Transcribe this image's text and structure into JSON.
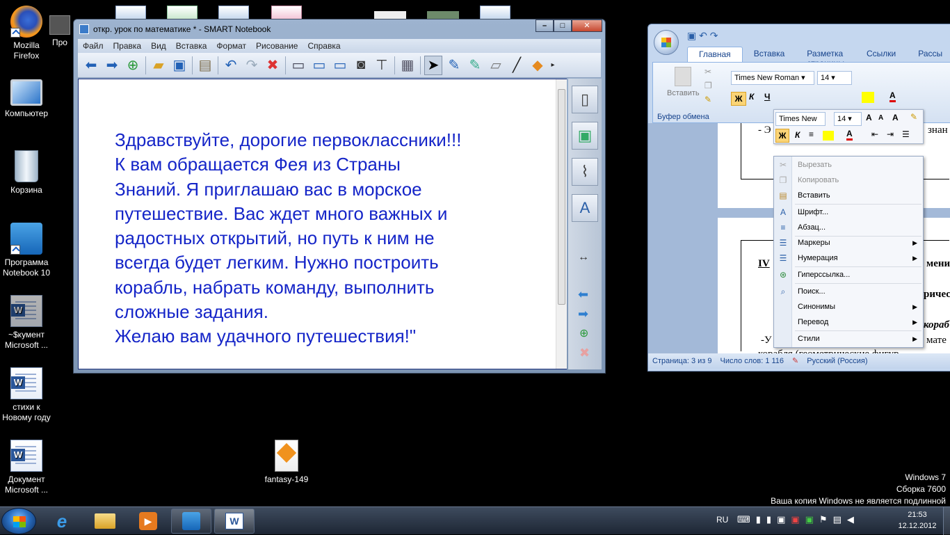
{
  "desktop_icons": [
    {
      "label1": "Mozilla",
      "label2": "Firefox",
      "icon": "firefox-icon"
    },
    {
      "label1": "Компьютер",
      "label2": "",
      "icon": "computer-icon"
    },
    {
      "label1": "Корзина",
      "label2": "",
      "icon": "recycle-bin-icon"
    },
    {
      "label1": "Программа",
      "label2": "Notebook 10",
      "icon": "smart-notebook-icon"
    },
    {
      "label1": "~$кумент",
      "label2": "Microsoft ...",
      "icon": "word-temp-icon"
    },
    {
      "label1": "стихи к",
      "label2": "Новому году",
      "icon": "word-doc-icon"
    },
    {
      "label1": "Документ",
      "label2": "Microsoft ...",
      "icon": "word-doc-icon"
    },
    {
      "label1": "fantasy-149",
      "label2": "",
      "icon": "scorm-icon"
    },
    {
      "label1": "Про",
      "label2": "",
      "icon": "program-icon"
    }
  ],
  "smart": {
    "title": "откр. урок по математике * - SMART Notebook",
    "menu": [
      "Файл",
      "Правка",
      "Вид",
      "Вставка",
      "Формат",
      "Рисование",
      "Справка"
    ],
    "page_text": "Здравствуйте, дорогие первоклассники!!!\nК вам обращается Фея из Страны\nЗнаний. Я приглашаю вас в морское\nпутешествие. Вас ждет много важных и\nрадостных открытий, но путь к ним не\nвсегда будет легким. Нужно построить\nкорабль, набрать команду, выполнить\nсложные задания.\nЖелаю вам удачного путешествия!\""
  },
  "word": {
    "tabs": [
      "Главная",
      "Вставка",
      "Разметка страницы",
      "Ссылки",
      "Рассы"
    ],
    "paste_label": "Вставить",
    "clipboard_label": "Буфер обмена",
    "font_name": "Times New Roman",
    "font_size": "14",
    "doc_line1": "- Э",
    "doc_line1b": "знан",
    "doc_line2": "IV",
    "doc_line2b": "мени",
    "doc_line3": "ричес",
    "doc_line4": "кораб",
    "doc_line5": "-У",
    "doc_line5b": "мате",
    "doc_line6": "корабля (геометрические фигур",
    "status_page": "Страница: 3 из 9",
    "status_words": "Число слов: 1 116",
    "status_lang": "Русский (Россия)"
  },
  "mini_toolbar": {
    "font_name": "Times New",
    "font_size": "14"
  },
  "context_menu": [
    {
      "label": "Вырезать",
      "disabled": true,
      "icon": "scissors-icon",
      "sub": false
    },
    {
      "label": "Копировать",
      "disabled": true,
      "icon": "copy-icon",
      "sub": false
    },
    {
      "label": "Вставить",
      "disabled": false,
      "icon": "paste-icon",
      "sub": false
    },
    {
      "label": "Шрифт...",
      "disabled": false,
      "icon": "font-icon",
      "sub": false
    },
    {
      "label": "Абзац...",
      "disabled": false,
      "icon": "paragraph-icon",
      "sub": false
    },
    {
      "label": "Маркеры",
      "disabled": false,
      "icon": "bullets-icon",
      "sub": true
    },
    {
      "label": "Нумерация",
      "disabled": false,
      "icon": "numbering-icon",
      "sub": true
    },
    {
      "label": "Гиперссылка...",
      "disabled": false,
      "icon": "hyperlink-icon",
      "sub": false
    },
    {
      "label": "Поиск...",
      "disabled": false,
      "icon": "search-icon",
      "sub": false
    },
    {
      "label": "Синонимы",
      "disabled": false,
      "icon": "",
      "sub": true
    },
    {
      "label": "Перевод",
      "disabled": false,
      "icon": "",
      "sub": true
    },
    {
      "label": "Стили",
      "disabled": false,
      "icon": "",
      "sub": true
    }
  ],
  "watermark": {
    "line1": "Windows 7",
    "line2": "Сборка 7600",
    "line3": "Ваша копия Windows не является подлинной"
  },
  "tray": {
    "lang": "RU",
    "time": "21:53",
    "date": "12.12.2012"
  }
}
